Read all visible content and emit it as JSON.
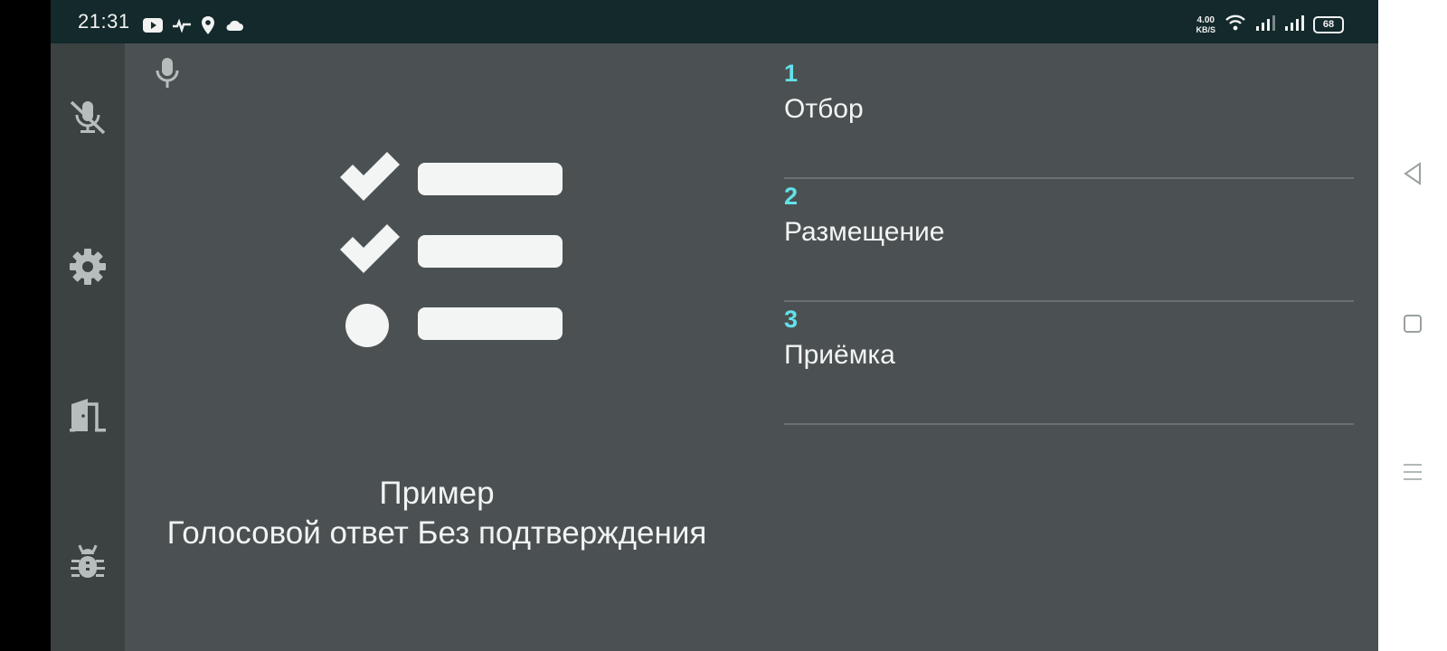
{
  "status_bar": {
    "time": "21:31",
    "net_speed_value": "4.00",
    "net_speed_unit": "KB/S",
    "battery_level": "68",
    "left_icons": [
      "youtube-icon",
      "sync-icon",
      "location-icon",
      "cloud-icon"
    ],
    "right_icons": [
      "wifi-icon",
      "signal-icon",
      "signal-icon"
    ]
  },
  "rail": {
    "buttons": [
      "mic-off-icon",
      "gear-icon",
      "exit-door-icon",
      "bug-icon"
    ]
  },
  "main": {
    "caption_line1": "Пример",
    "caption_line2": "Голосовой ответ Без подтверждения"
  },
  "menu": {
    "items": [
      {
        "number": "1",
        "label": "Отбор"
      },
      {
        "number": "2",
        "label": "Размещение"
      },
      {
        "number": "3",
        "label": "Приёмка"
      }
    ]
  },
  "colors": {
    "accent": "#63e1ea",
    "main_bg": "#4b5152",
    "rail_bg": "#3c4142",
    "status_bg": "#13292b"
  }
}
